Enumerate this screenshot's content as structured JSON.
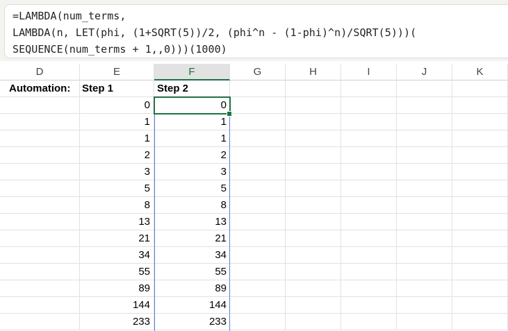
{
  "formula": {
    "line1": "=LAMBDA(num_terms,",
    "line2": "LAMBDA(n, LET(phi, (1+SQRT(5))/2, (phi^n - (1-phi)^n)/SQRT(5)))(",
    "line3": "SEQUENCE(num_terms + 1,,0)))(1000)"
  },
  "columns": [
    "D",
    "E",
    "F",
    "G",
    "H",
    "I",
    "J",
    "K"
  ],
  "selected_column": "F",
  "headers": {
    "D": "Automation:",
    "E": "Step 1",
    "F": "Step 2"
  },
  "step1_values": [
    "0",
    "1",
    "1",
    "2",
    "3",
    "5",
    "8",
    "13",
    "21",
    "34",
    "55",
    "89",
    "144",
    "233"
  ],
  "step2_values": [
    "0",
    "1",
    "1",
    "2",
    "3",
    "5",
    "8",
    "13",
    "21",
    "34",
    "55",
    "89",
    "144",
    "233"
  ],
  "colors": {
    "selection_green": "#1e7145",
    "spill_blue": "#5b7fcf"
  }
}
